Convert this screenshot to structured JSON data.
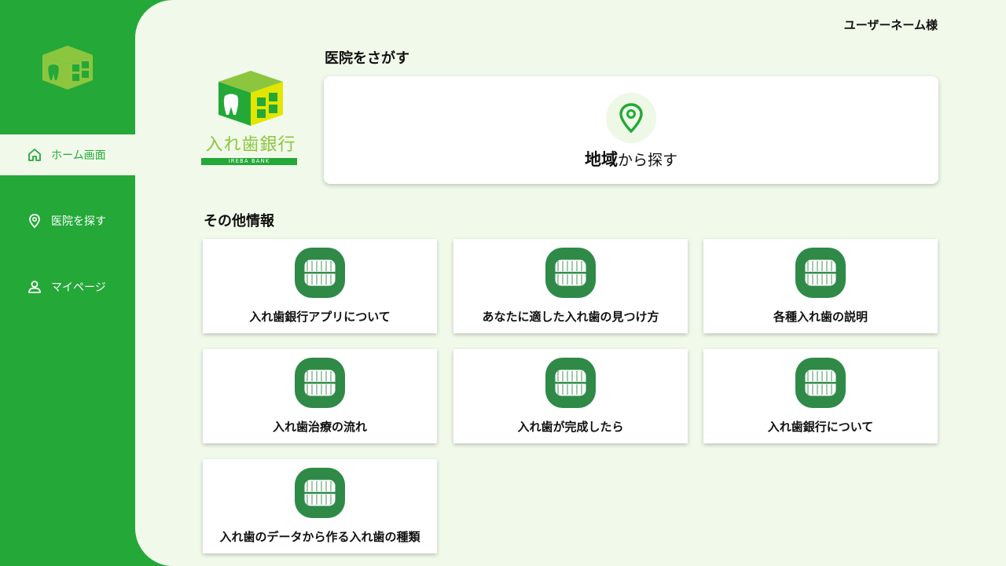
{
  "sidebar": {
    "items": [
      {
        "label": "ホーム画面",
        "icon": "home-icon",
        "active": true
      },
      {
        "label": "医院を探す",
        "icon": "location-pin-icon",
        "active": false
      },
      {
        "label": "マイページ",
        "icon": "user-icon",
        "active": false
      }
    ]
  },
  "header": {
    "username": "ユーザーネーム様"
  },
  "brand": {
    "name": "入れ歯銀行",
    "sub": "IREBA BANK"
  },
  "search_section": {
    "title": "医院をさがす",
    "card_bold": "地域",
    "card_rest": "から探す",
    "icon": "location-pin-icon"
  },
  "info_section": {
    "title": "その他情報",
    "cards": [
      {
        "label": "入れ歯銀行アプリについて",
        "icon": "dentures-icon"
      },
      {
        "label": "あなたに適した入れ歯の見つけ方",
        "icon": "dentures-icon"
      },
      {
        "label": "各種入れ歯の説明",
        "icon": "dentures-icon"
      },
      {
        "label": "入れ歯治療の流れ",
        "icon": "dentures-icon"
      },
      {
        "label": "入れ歯が完成したら",
        "icon": "dentures-icon"
      },
      {
        "label": "入れ歯銀行について",
        "icon": "dentures-icon"
      },
      {
        "label": "入れ歯のデータから作る入れ歯の種類",
        "icon": "dentures-icon"
      }
    ]
  },
  "colors": {
    "primary": "#24a838",
    "background": "#f1faea",
    "logo_light": "#8cc63f",
    "logo_yellow": "#e3e600",
    "icon_bg": "#2f8a48"
  }
}
